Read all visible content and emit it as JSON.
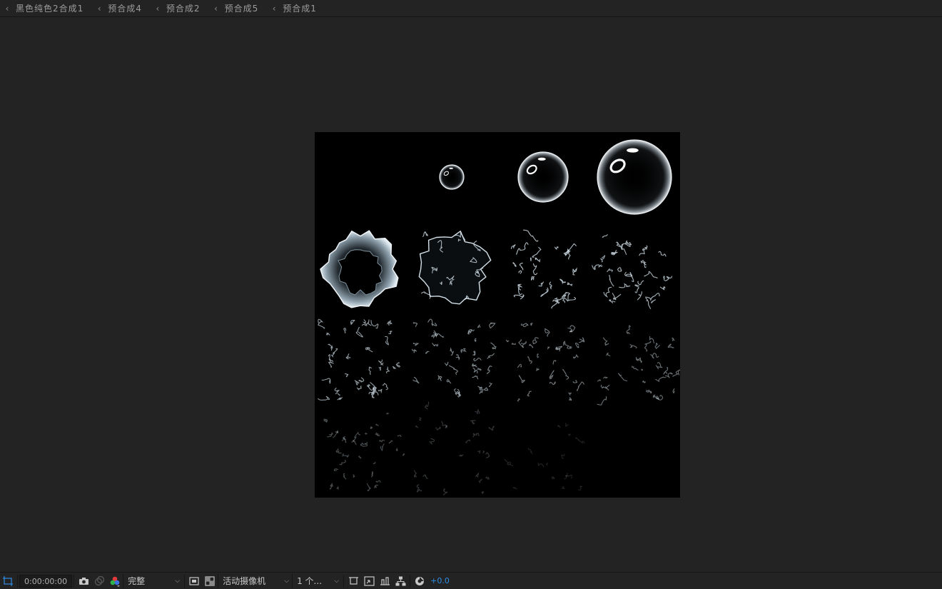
{
  "breadcrumb": {
    "items": [
      {
        "label": "黑色纯色2合成1"
      },
      {
        "label": "预合成4"
      },
      {
        "label": "预合成2"
      },
      {
        "label": "预合成5"
      },
      {
        "label": "预合成1"
      }
    ],
    "arrow_glyph": "‹"
  },
  "toolbar": {
    "timecode": "0:00:00:00",
    "resolution": "完整",
    "camera": "活动摄像机",
    "views": "1 个...",
    "exposure": "+0.0",
    "accent_color": "#2f8de4",
    "icons": {
      "region": "region-of-interest-icon",
      "snapshot": "camera-snapshot-icon",
      "show_snapshot": "show-snapshot-icon",
      "color_channels": "rgb-channels-icon",
      "transparency_grid": "transparency-grid-icon",
      "toggle_mask": "toggle-mask-icon",
      "guides": "guides-icon",
      "fast_preview": "fast-preview-icon",
      "flowchart": "flowchart-icon",
      "timeline": "timeline-icon",
      "reset_exposure": "reset-exposure-icon"
    }
  },
  "viewer": {
    "background": "#232323",
    "comp_background": "#000000",
    "content": "bubble pop sprite sheet: 4 bubbles growing, then bursting into splashes"
  }
}
